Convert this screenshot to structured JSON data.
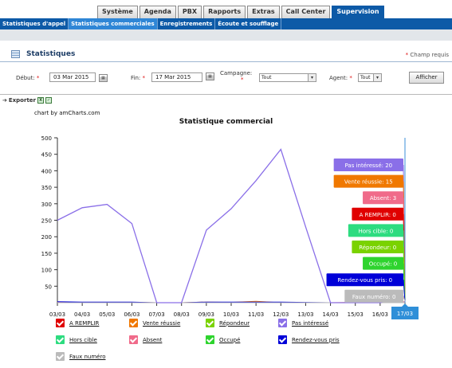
{
  "top_tabs": [
    {
      "label": "Système",
      "active": false
    },
    {
      "label": "Agenda",
      "active": false
    },
    {
      "label": "PBX",
      "active": false
    },
    {
      "label": "Rapports",
      "active": false
    },
    {
      "label": "Extras",
      "active": false
    },
    {
      "label": "Call Center",
      "active": false
    },
    {
      "label": "Supervision",
      "active": true
    }
  ],
  "sub_nav": [
    {
      "label": "Statistiques d'appel",
      "active": false
    },
    {
      "label": "Statistiques commerciales",
      "active": true
    },
    {
      "label": "Enregistrements",
      "active": false
    },
    {
      "label": "Écoute et soufflage",
      "active": false
    }
  ],
  "section": {
    "title": "Statistiques",
    "required_note": "Champ requis",
    "required_star": "*"
  },
  "filters": {
    "start_label": "Début:",
    "start_value": "03 Mar 2015",
    "end_label": "Fin:",
    "end_value": "17 Mar 2015",
    "campaign_label": "Campagne:",
    "campaign_value": "Tout",
    "agent_label": "Agent:",
    "agent_value": "Tout",
    "submit_label": "Afficher",
    "star": "*"
  },
  "export": {
    "label": "Exporter"
  },
  "chart_credit": "chart by amCharts.com",
  "chart_data": {
    "type": "line",
    "title": "Statistique commercial",
    "x": [
      "03/03",
      "04/03",
      "05/03",
      "06/03",
      "07/03",
      "08/03",
      "09/03",
      "10/03",
      "11/03",
      "12/03",
      "13/03",
      "14/03",
      "15/03",
      "16/03",
      "17/03"
    ],
    "ylim": [
      0,
      500
    ],
    "yticks": [
      50,
      100,
      150,
      200,
      250,
      300,
      350,
      400,
      450,
      500
    ],
    "grid": false,
    "legend_position": "bottom",
    "series": [
      {
        "name": "A REMPLIR",
        "color": "#e00000",
        "values": [
          0,
          0,
          0,
          0,
          0,
          0,
          0,
          0,
          0,
          0,
          0,
          0,
          0,
          0,
          0
        ]
      },
      {
        "name": "Vente réussie",
        "color": "#f07800",
        "values": [
          2,
          1,
          1,
          1,
          0,
          0,
          2,
          1,
          4,
          0,
          0,
          0,
          1,
          1,
          15
        ]
      },
      {
        "name": "Répondeur",
        "color": "#7ad200",
        "values": [
          0,
          0,
          0,
          0,
          0,
          0,
          0,
          0,
          0,
          0,
          0,
          0,
          0,
          0,
          0
        ]
      },
      {
        "name": "Pas intéressé",
        "color": "#8a6fe8",
        "values": [
          250,
          288,
          298,
          240,
          0,
          0,
          220,
          285,
          370,
          465,
          230,
          0,
          0,
          0,
          20
        ]
      },
      {
        "name": "Hors cible",
        "color": "#2ddc80",
        "values": [
          0,
          0,
          0,
          0,
          0,
          0,
          0,
          0,
          0,
          0,
          0,
          0,
          0,
          0,
          0
        ]
      },
      {
        "name": "Absent",
        "color": "#f06b8a",
        "values": [
          1,
          0,
          0,
          0,
          0,
          0,
          0,
          0,
          0,
          1,
          0,
          0,
          0,
          0,
          3
        ]
      },
      {
        "name": "Occupé",
        "color": "#2ed42e",
        "values": [
          0,
          0,
          0,
          0,
          0,
          0,
          0,
          0,
          0,
          0,
          0,
          0,
          0,
          0,
          0
        ]
      },
      {
        "name": "Rendez-vous pris",
        "color": "#0000d8",
        "values": [
          3,
          2,
          2,
          2,
          0,
          0,
          2,
          2,
          2,
          2,
          1,
          0,
          0,
          0,
          0
        ]
      },
      {
        "name": "Faux numéro",
        "color": "#bbbbbb",
        "values": [
          0,
          0,
          0,
          0,
          0,
          0,
          0,
          0,
          0,
          0,
          0,
          0,
          0,
          0,
          0
        ]
      }
    ],
    "cursor": {
      "x": "17/03",
      "label": "17/03"
    },
    "balloons": [
      {
        "text": "Pas intéressé: 20",
        "color": "#8a6fe8"
      },
      {
        "text": "Vente réussie: 15",
        "color": "#f07800"
      },
      {
        "text": "Absent: 3",
        "color": "#f06b8a"
      },
      {
        "text": "A REMPLIR: 0",
        "color": "#e00000"
      },
      {
        "text": "Hors cible: 0",
        "color": "#2ddc80"
      },
      {
        "text": "Répondeur: 0",
        "color": "#7ad200"
      },
      {
        "text": "Occupé: 0",
        "color": "#2ed42e"
      },
      {
        "text": "Rendez-vous pris: 0",
        "color": "#0000d8"
      },
      {
        "text": "Faux numéro: 0",
        "color": "#bbbbbb"
      }
    ]
  }
}
